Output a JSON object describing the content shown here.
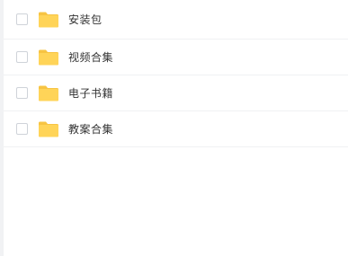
{
  "files": [
    {
      "name": "安装包",
      "icon": "folder-icon",
      "checked": false
    },
    {
      "name": "视频合集",
      "icon": "folder-icon",
      "checked": false
    },
    {
      "name": "电子书籍",
      "icon": "folder-icon",
      "checked": false
    },
    {
      "name": "教案合集",
      "icon": "folder-icon",
      "checked": false
    }
  ],
  "colors": {
    "folder": "#FFD458",
    "folder_tab": "#F7C443",
    "text": "#333333",
    "divider": "#F0F1F3",
    "checkbox_border": "#CFD3D9"
  }
}
